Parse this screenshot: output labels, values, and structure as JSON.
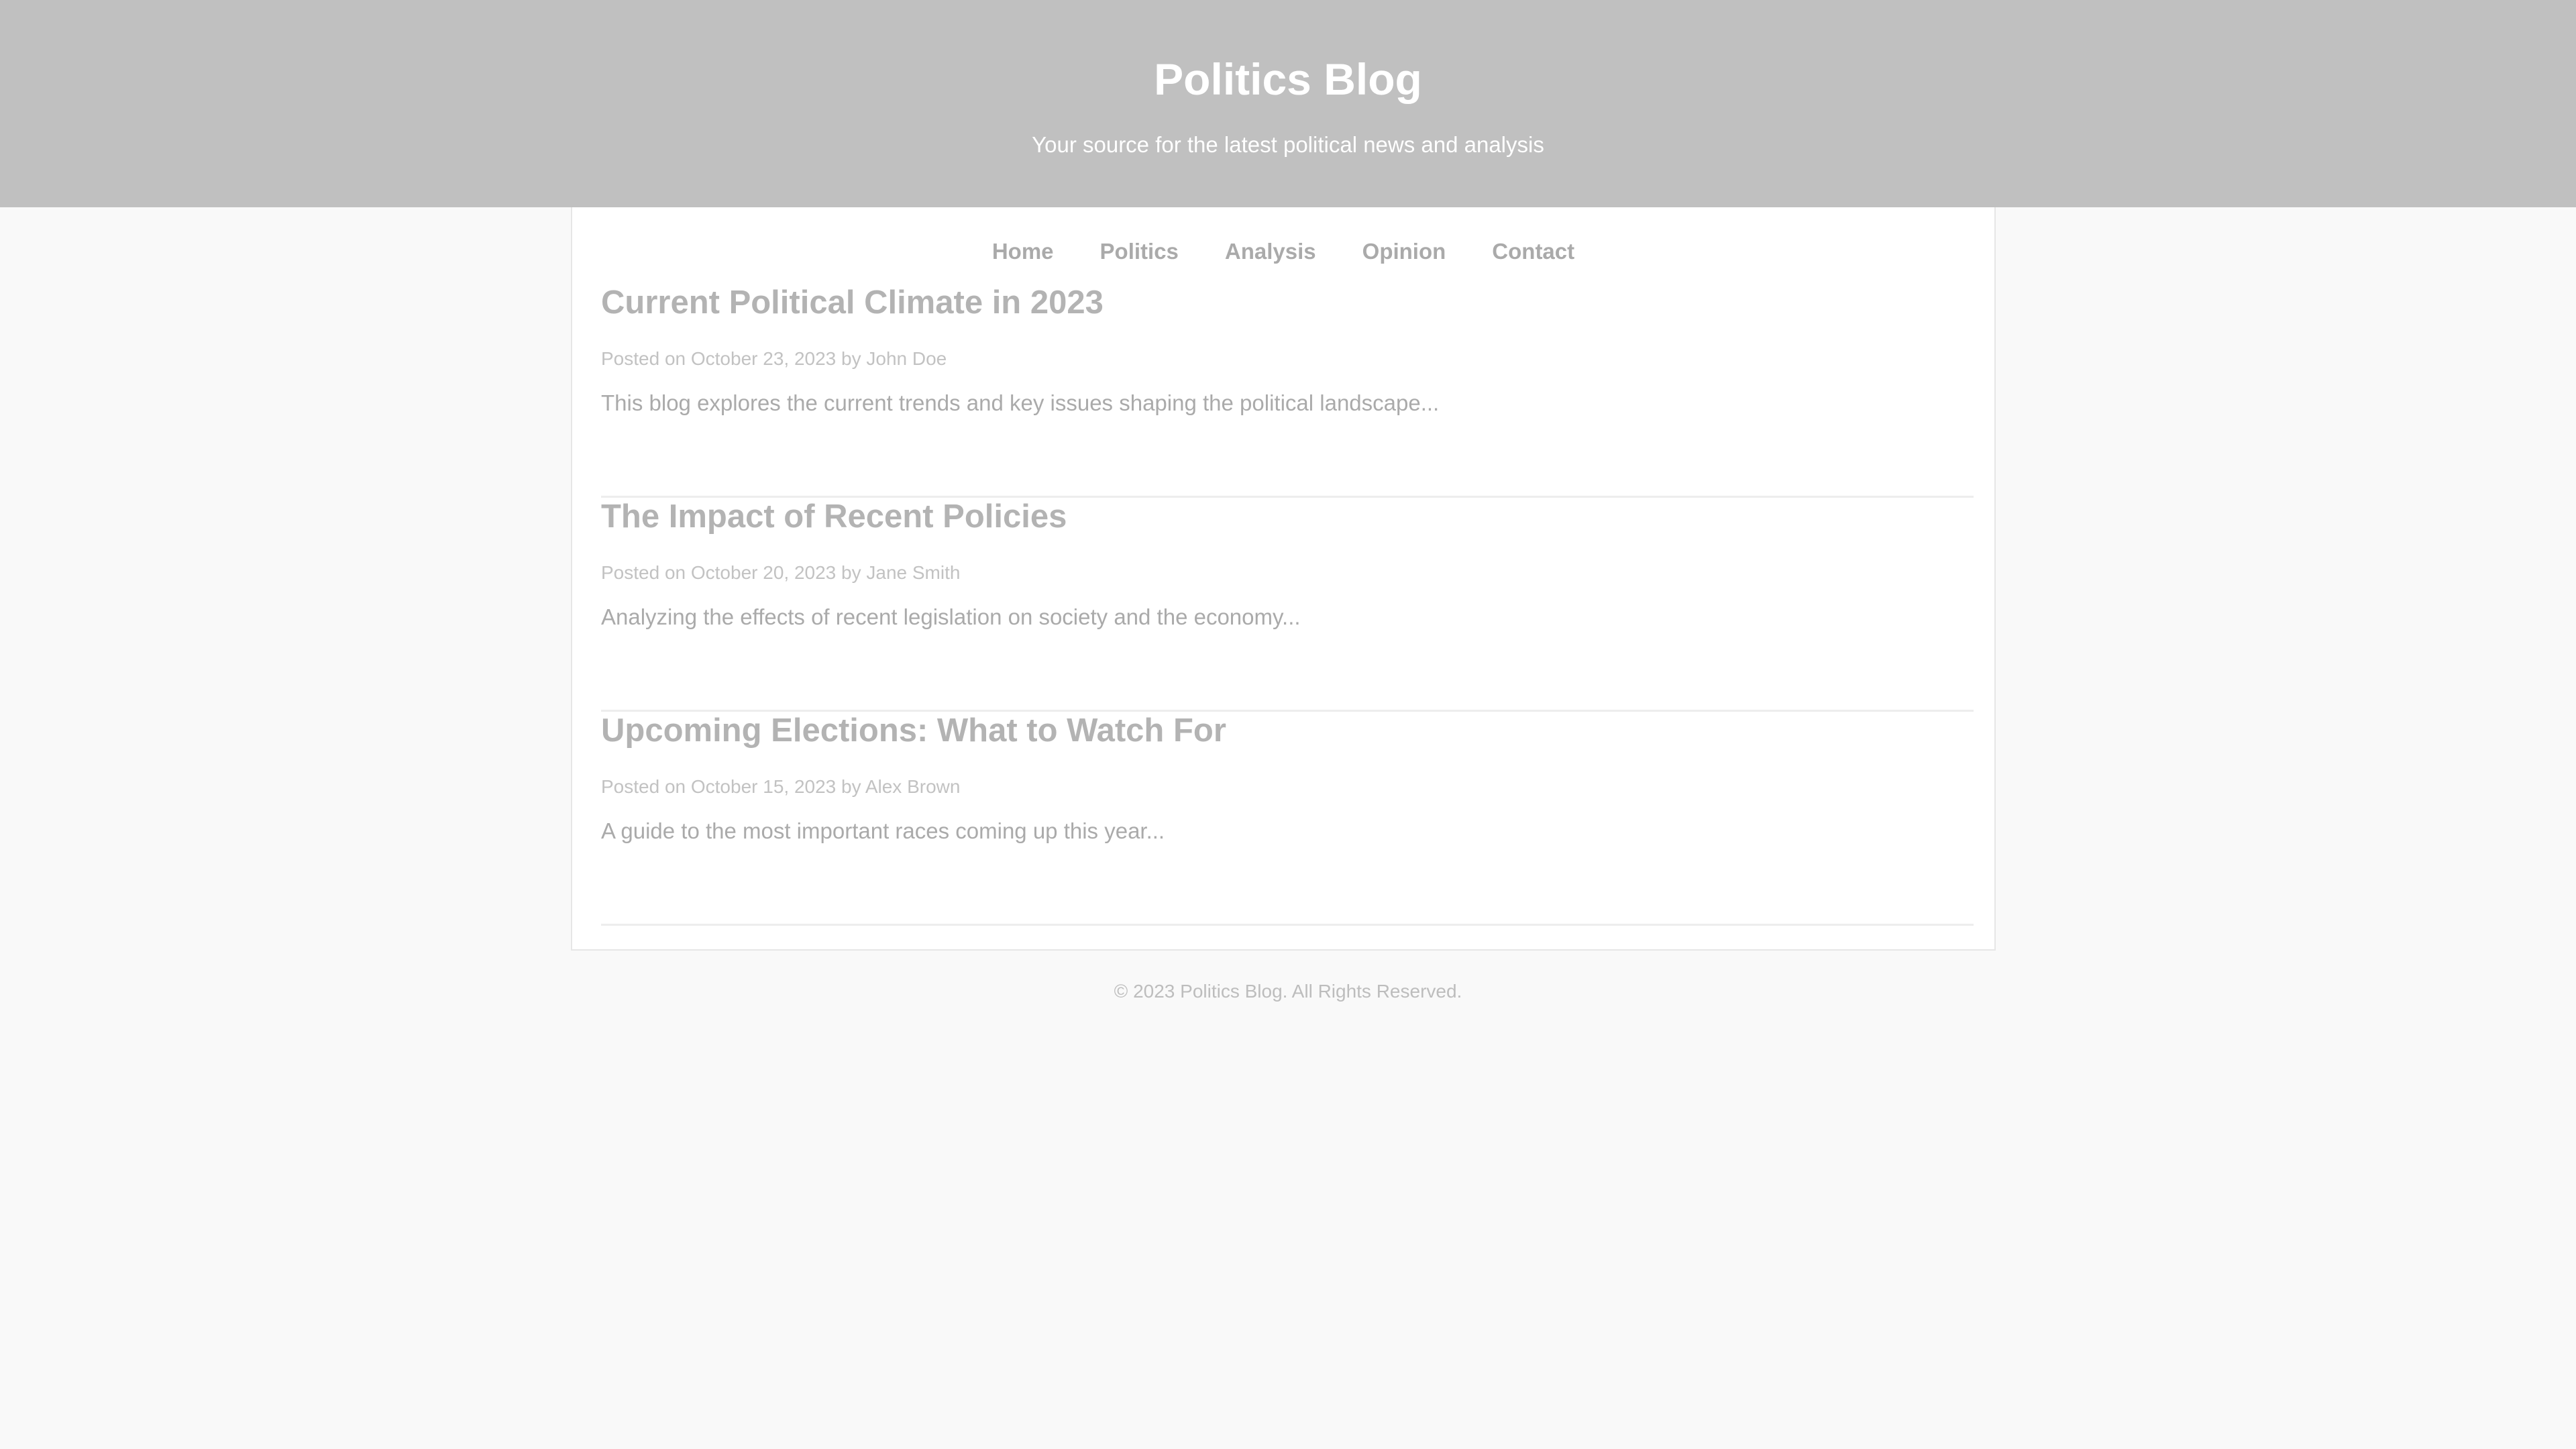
{
  "header": {
    "title": "Politics Blog",
    "tagline": "Your source for the latest political news and analysis"
  },
  "nav": {
    "items": [
      {
        "label": "Home"
      },
      {
        "label": "Politics"
      },
      {
        "label": "Analysis"
      },
      {
        "label": "Opinion"
      },
      {
        "label": "Contact"
      }
    ]
  },
  "posts": [
    {
      "title": "Current Political Climate in 2023",
      "meta": "Posted on October 23, 2023 by John Doe",
      "excerpt": "This blog explores the current trends and key issues shaping the political landscape..."
    },
    {
      "title": "The Impact of Recent Policies",
      "meta": "Posted on October 20, 2023 by Jane Smith",
      "excerpt": "Analyzing the effects of recent legislation on society and the economy..."
    },
    {
      "title": "Upcoming Elections: What to Watch For",
      "meta": "Posted on October 15, 2023 by Alex Brown",
      "excerpt": "A guide to the most important races coming up this year..."
    }
  ],
  "footer": {
    "text": "© 2023 Politics Blog. All Rights Reserved."
  },
  "colors": {
    "header_bg": "#c0c0c0",
    "page_bg": "#f9f9f9",
    "nav_text": "#aaaaaa",
    "post_title": "#b3b3b3"
  }
}
